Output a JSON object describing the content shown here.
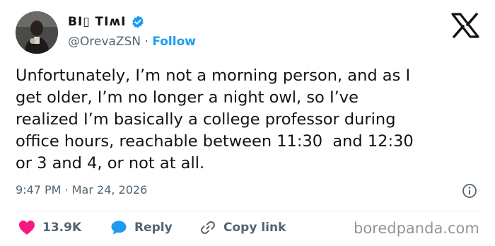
{
  "author": {
    "display_name": "BI▯ TIʍI",
    "handle": "@OrevaZSN",
    "separator": " · ",
    "follow_label": "Follow",
    "avatar_icon": "profile-photo",
    "verified_color": "#1d9bf0"
  },
  "tweet": {
    "text": "Unfortunately, I’m not a morning person, and as I\nget older, I’m no longer a night owl, so I’ve\nrealized I’m basically a college professor during\noffice hours, reachable between 11:30  and 12:30\nor 3 and 4, or not at all.",
    "time": "9:47 PM",
    "meta_separator": " · ",
    "date": "Mar 24, 2026"
  },
  "actions": {
    "like_count": "13.9K",
    "reply_label": "Reply",
    "copy_link_label": "Copy link"
  },
  "watermark": "boredpanda.com",
  "colors": {
    "accent": "#1d9bf0",
    "like": "#f91880",
    "secondary_text": "#536471"
  }
}
